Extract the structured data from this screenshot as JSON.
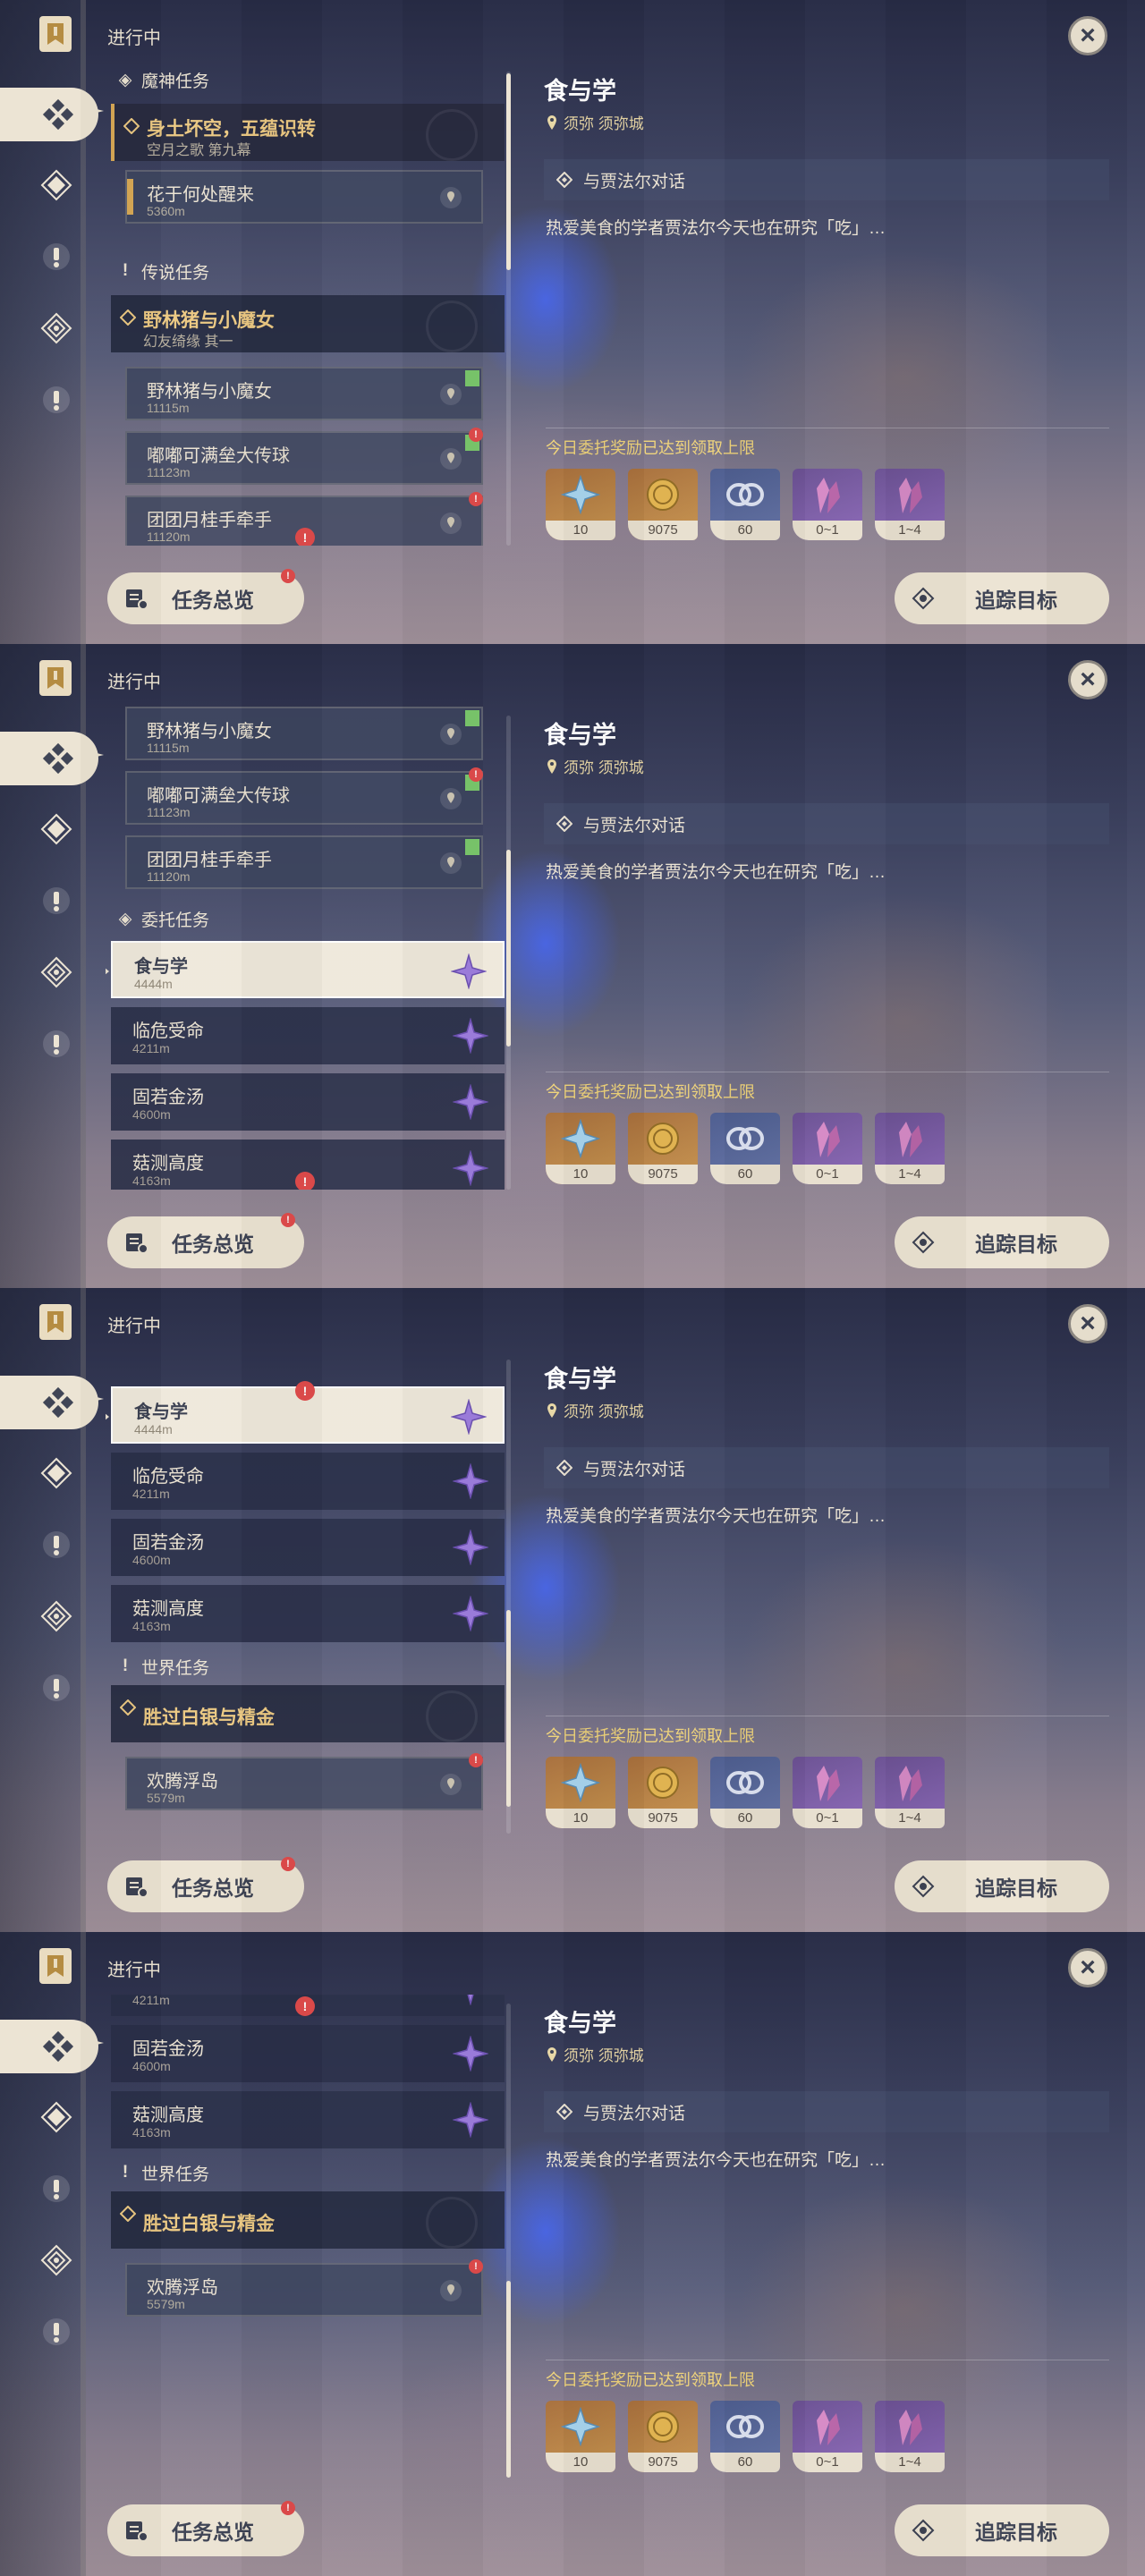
{
  "status_title": "进行中",
  "close_label": "×",
  "detail": {
    "title": "食与学",
    "location": "须弥 须弥城",
    "objective": "与贾法尔对话",
    "description": "热爱美食的学者贾法尔今天也在研究「吃」…",
    "reward_label": "今日委托奖励已达到领取上限",
    "rewards": [
      {
        "icon": "primogem-icon",
        "qty": "10"
      },
      {
        "icon": "mora-icon",
        "qty": "9075"
      },
      {
        "icon": "adventure-exp-icon",
        "qty": "60"
      },
      {
        "icon": "crystal-icon",
        "qty": "0~1"
      },
      {
        "icon": "crystal-icon",
        "qty": "1~4"
      }
    ]
  },
  "buttons": {
    "overview": "任务总览",
    "track": "追踪目标"
  },
  "categories": {
    "archon": "魔神任务",
    "story": "传说任务",
    "commission": "委托任务",
    "world": "世界任务"
  },
  "archon": {
    "title": "身土坏空，五蕴识转",
    "subtitle": "空月之歌 第九幕",
    "sub": {
      "title": "花于何处醒来",
      "dist": "5360m"
    }
  },
  "story": {
    "title": "野林猪与小魔女",
    "subtitle": "幻友绮缘 其一",
    "subs": [
      {
        "title": "野林猪与小魔女",
        "dist": "11115m"
      },
      {
        "title": "嘟嘟可满垒大传球",
        "dist": "11123m"
      },
      {
        "title": "团团月桂手牵手",
        "dist": "11120m"
      }
    ]
  },
  "commissions": [
    {
      "title": "食与学",
      "dist": "4444m"
    },
    {
      "title": "临危受命",
      "dist": "4211m"
    },
    {
      "title": "固若金汤",
      "dist": "4600m"
    },
    {
      "title": "菇测高度",
      "dist": "4163m"
    }
  ],
  "world": {
    "title": "胜过白银与精金",
    "sub": {
      "title": "欢腾浮岛",
      "dist": "5579m"
    }
  }
}
